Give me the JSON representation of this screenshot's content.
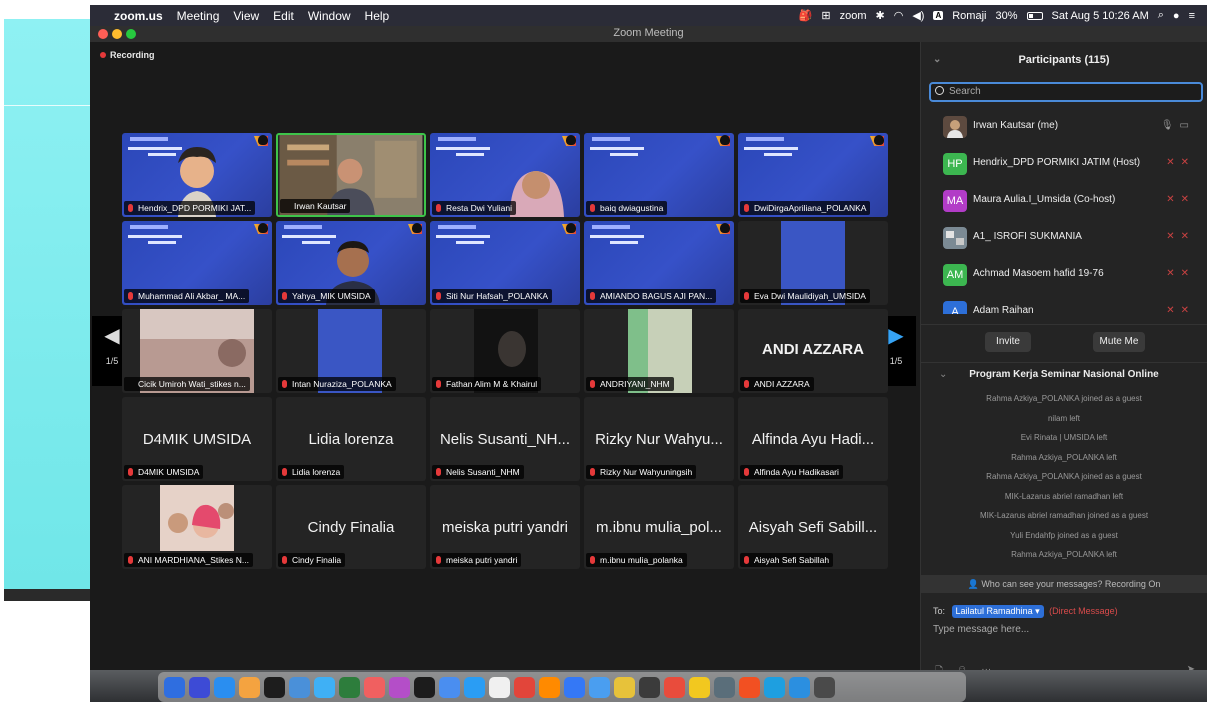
{
  "menubar": {
    "app": "zoom.us",
    "items": [
      "Meeting",
      "View",
      "Edit",
      "Window",
      "Help"
    ],
    "status": {
      "zoom": "zoom",
      "input_source": "Romaji",
      "battery": "30%",
      "clock": "Sat Aug 5 10:26 AM"
    }
  },
  "window": {
    "title": "Zoom Meeting",
    "recording": "Recording"
  },
  "nav": {
    "left_page": "1/5",
    "right_page": "1/5"
  },
  "tiles": [
    {
      "name": "Hendrix_DPD PORMIKI JAT..."
    },
    {
      "name": "Irwan Kautsar"
    },
    {
      "name": "Resta Dwi Yuliani"
    },
    {
      "name": "baiq dwiagustina"
    },
    {
      "name": "DwiDirgaApriliana_POLANKA"
    },
    {
      "name": "Muhammad Ali Akbar_ MA..."
    },
    {
      "name": "Yahya_MIK UMSIDA"
    },
    {
      "name": "Siti Nur Hafsah_POLANKA"
    },
    {
      "name": "AMIANDO BAGUS AJI PAN..."
    },
    {
      "name": "Eva Dwi Maulidiyah_UMSIDA"
    },
    {
      "name": "Cicik Umiroh Wati_stikes n..."
    },
    {
      "name": "Intan Nuraziza_POLANKA"
    },
    {
      "name": "Fathan Alim M & Khairul"
    },
    {
      "name": "ANDRIYANI_NHM"
    },
    {
      "name": "ANDI AZZARA",
      "big": "ANDI AZZARA"
    },
    {
      "name": "D4MIK UMSIDA",
      "big": "D4MIK UMSIDA"
    },
    {
      "name": "Lidia lorenza",
      "big": "Lidia lorenza"
    },
    {
      "name": "Nelis Susanti_NHM",
      "big": "Nelis Susanti_NH..."
    },
    {
      "name": "Rizky Nur Wahyuningsih",
      "big": "Rizky Nur Wahyu..."
    },
    {
      "name": "Alfinda Ayu Hadikasari",
      "big": "Alfinda Ayu Hadi..."
    },
    {
      "name": "ANI MARDHIANA_Stikes N..."
    },
    {
      "name": "Cindy Finalia",
      "big": "Cindy Finalia"
    },
    {
      "name": "meiska putri yandri",
      "big": "meiska putri yandri"
    },
    {
      "name": "m.ibnu mulia_polanka",
      "big": "m.ibnu mulia_pol..."
    },
    {
      "name": "Aisyah Sefi Sabillah",
      "big": "Aisyah Sefi Sabill..."
    }
  ],
  "panel": {
    "title": "Participants (115)",
    "search_placeholder": "Search",
    "participants": [
      {
        "initials": "",
        "name": "Irwan Kautsar (me)",
        "color": "#c7a07a"
      },
      {
        "initials": "HP",
        "name": "Hendrix_DPD PORMIKI JATIM (Host)",
        "color": "#3cb650"
      },
      {
        "initials": "MA",
        "name": "Maura Aulia.I_Umsida (Co-host)",
        "color": "#b23cc7"
      },
      {
        "initials": "",
        "name": "A1_ ISROFI SUKMANIA",
        "color": "#7b8a94"
      },
      {
        "initials": "AM",
        "name": "Achmad Masoem hafid 19-76",
        "color": "#3cb650"
      },
      {
        "initials": "A",
        "name": "Adam Raihan",
        "color": "#2d6fd8"
      }
    ],
    "invite": "Invite",
    "mute_me": "Mute Me"
  },
  "chat": {
    "title": "Program Kerja Seminar Nasional Online",
    "messages": [
      "Rahma Azkiya_POLANKA joined as a guest",
      "nilam left",
      "Evi Rinata | UMSIDA left",
      "Rahma Azkiya_POLANKA left",
      "Rahma Azkiya_POLANKA joined as a guest",
      "MIK-Lazarus abriel ramadhan left",
      "MIK-Lazarus abriel ramadhan joined as a guest",
      "Yuli Endahfp joined as a guest",
      "Rahma Azkiya_POLANKA left"
    ],
    "notice": "Who can see your messages? Recording On",
    "to_label": "To:",
    "recipient": "Lailatul Ramadhina",
    "dm_label": "(Direct Message)",
    "placeholder": "Type message here..."
  },
  "dock": {
    "colors": [
      "#2f6ee0",
      "#3d4bd6",
      "#2a8ef0",
      "#f4a340",
      "#1d1d1d",
      "#4a90d9",
      "#3fb0f5",
      "#2d7d3c",
      "#f06060",
      "#b44ec8",
      "#1c1c1c",
      "#4a8ef0",
      "#2a9df4",
      "#f0f0f0",
      "#e2453a",
      "#ff8a00",
      "#3478f6",
      "#4a9ef0",
      "#e7c23a",
      "#3b3b3b",
      "#e94c3c",
      "#f2c81f",
      "#5a6e7a",
      "#f25022",
      "#1e9fe0",
      "#2b8fe0",
      "#4a4a4a"
    ]
  }
}
